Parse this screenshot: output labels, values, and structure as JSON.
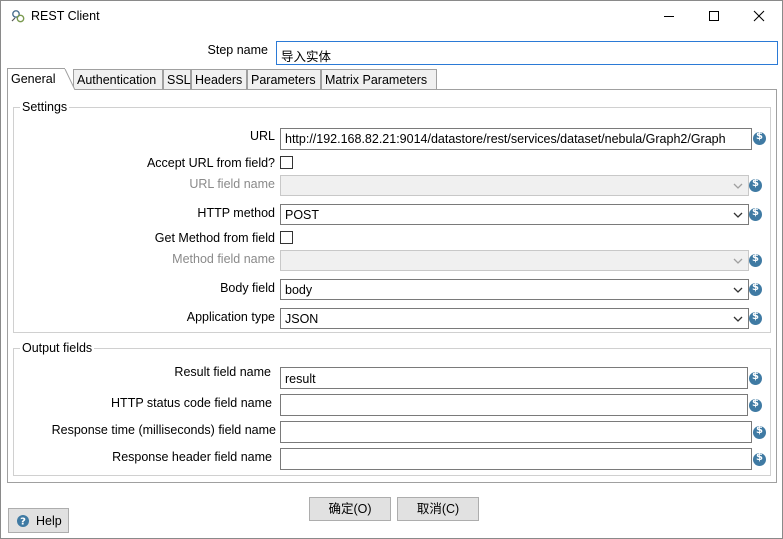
{
  "window": {
    "title": "REST Client"
  },
  "step": {
    "label": "Step name",
    "value": "导入实体"
  },
  "tabs": [
    "General",
    "Authentication",
    "SSL",
    "Headers",
    "Parameters",
    "Matrix Parameters"
  ],
  "settings": {
    "title": "Settings",
    "url_label": "URL",
    "url_value": "http://192.168.82.21:9014/datastore/rest/services/dataset/nebula/Graph2/Graph",
    "accept_url_label": "Accept URL from field?",
    "url_field_name_label": "URL field name",
    "http_method_label": "HTTP method",
    "http_method_value": "POST",
    "get_method_label": "Get Method from field",
    "method_field_name_label": "Method field name",
    "body_field_label": "Body field",
    "body_field_value": "body",
    "app_type_label": "Application type",
    "app_type_value": "JSON"
  },
  "output": {
    "title": "Output fields",
    "result_label": "Result field name",
    "result_value": "result",
    "status_label": "HTTP status code field name",
    "response_time_label": "Response time (milliseconds) field name",
    "response_header_label": "Response header field name"
  },
  "buttons": {
    "ok": "确定(O)",
    "cancel": "取消(C)",
    "help": "Help"
  },
  "icons": {
    "variable": "$"
  }
}
